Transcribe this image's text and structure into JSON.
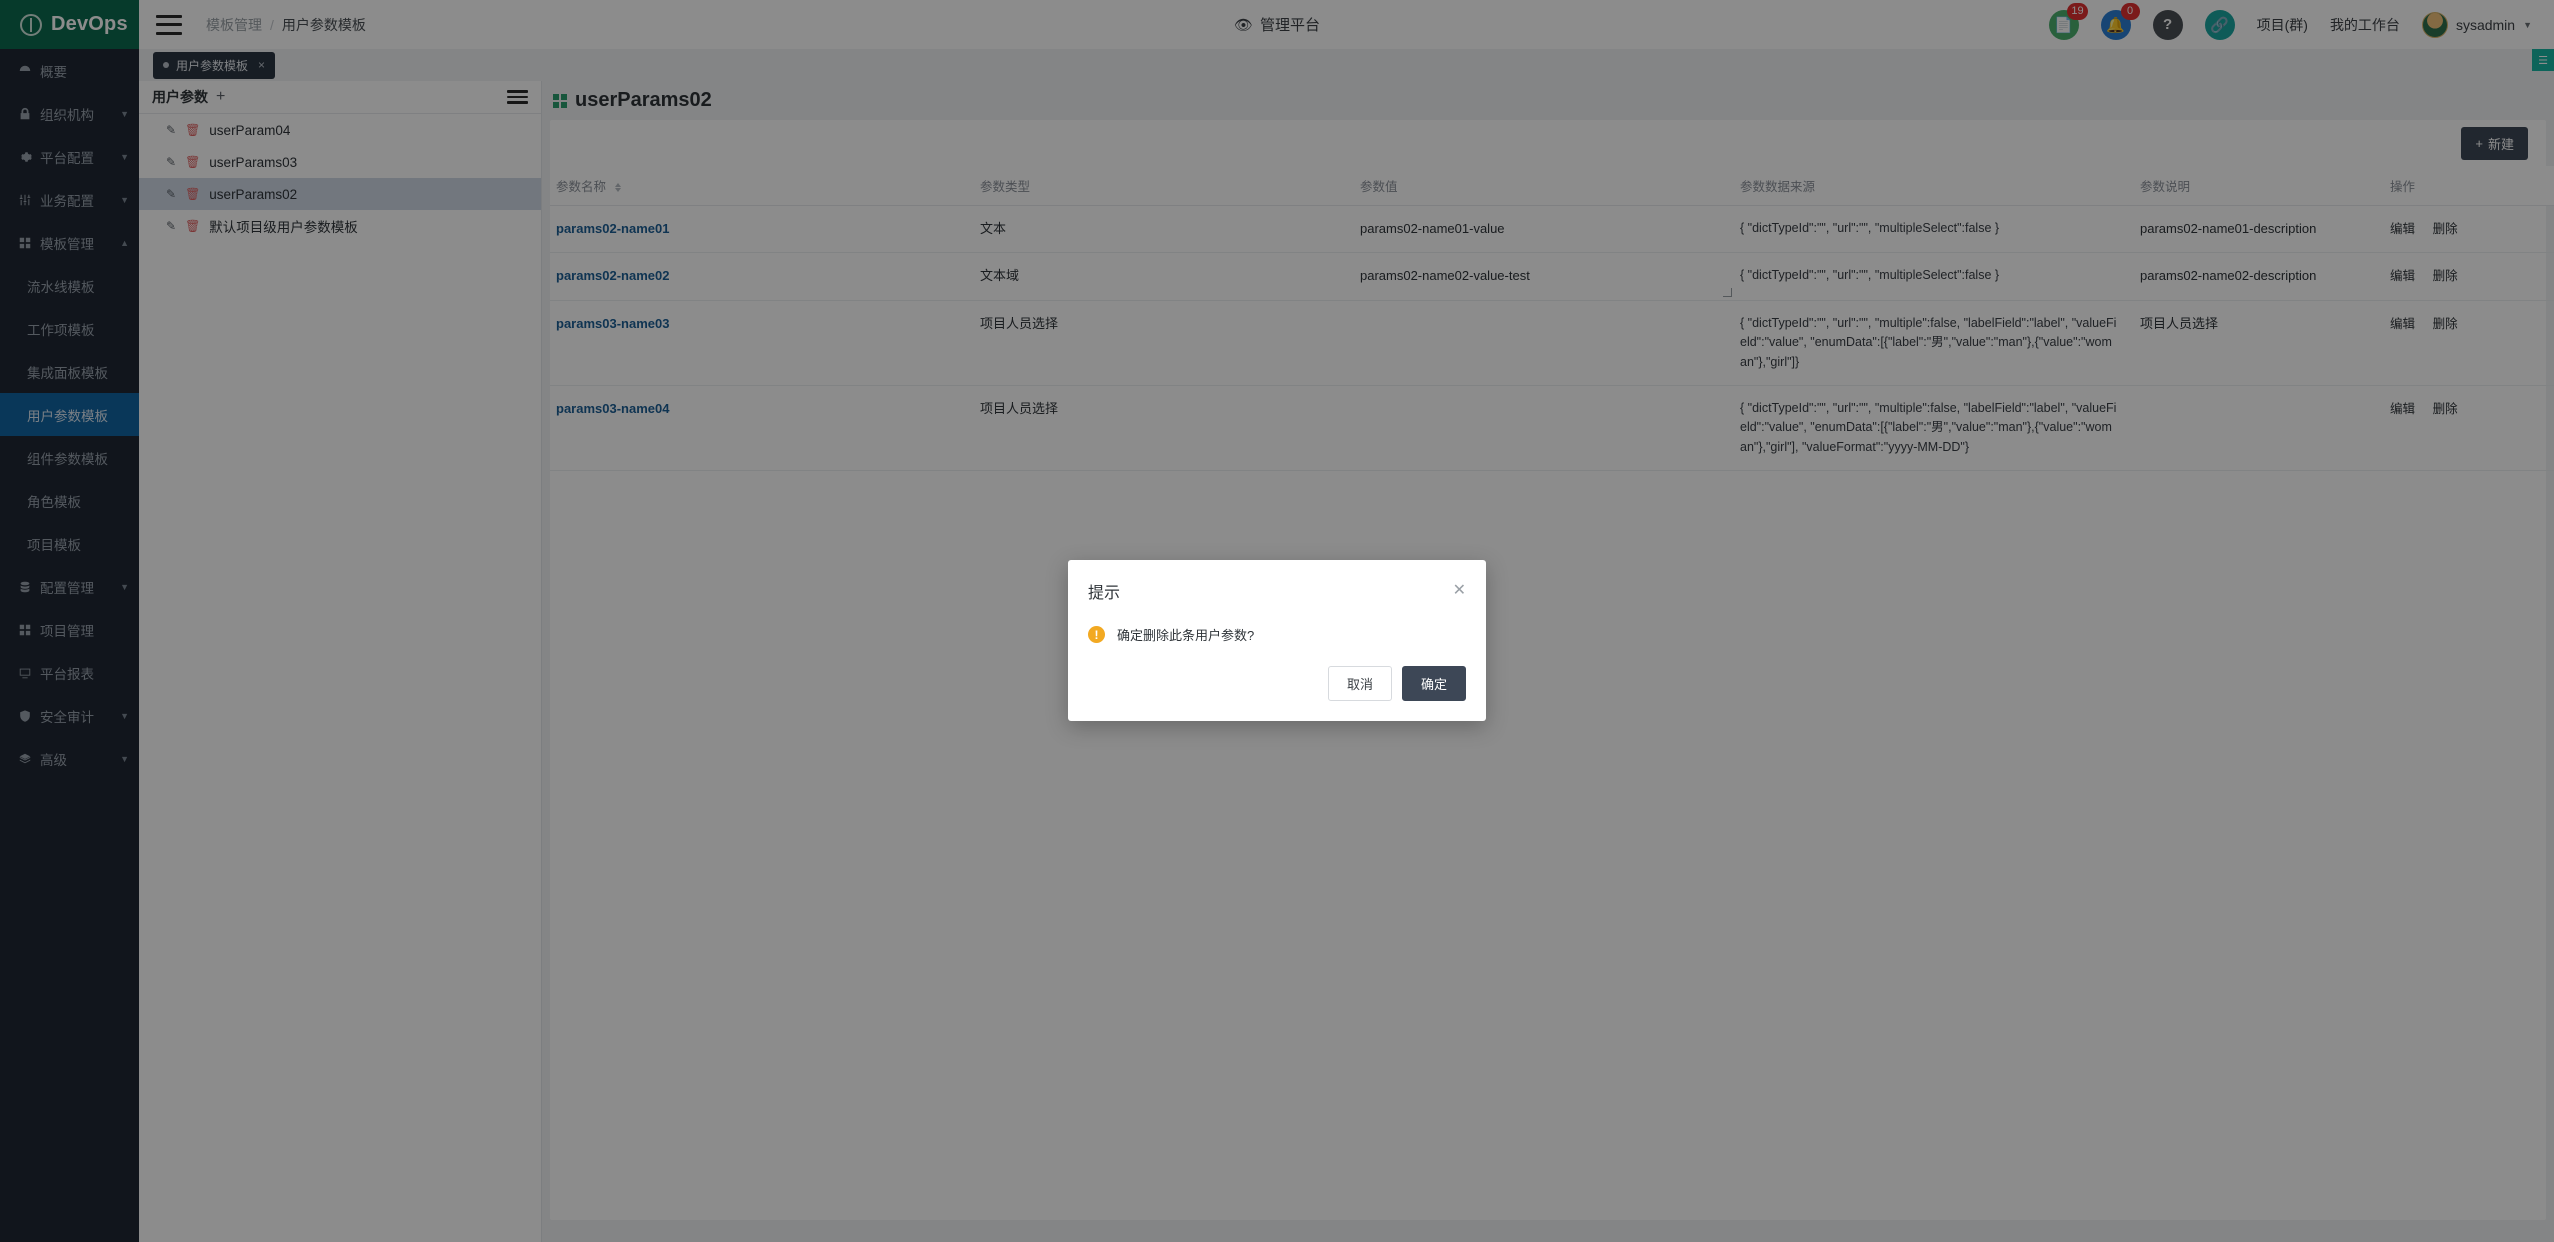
{
  "brand": {
    "name": "DevOps"
  },
  "header": {
    "breadcrumb": [
      "模板管理",
      "/",
      "用户参数模板"
    ],
    "platform_title": "管理平台",
    "eye_icon": "eye-icon",
    "doc_badge": "19",
    "bell_badge": "0",
    "links": [
      "项目(群)",
      "我的工作台"
    ],
    "user": "sysadmin"
  },
  "tab_chip": {
    "label": "用户参数模板",
    "close": "×"
  },
  "sidebar": {
    "items": [
      {
        "label": "概要",
        "icon": "dashboard-icon",
        "expandable": false
      },
      {
        "label": "组织机构",
        "icon": "lock-icon",
        "expandable": true
      },
      {
        "label": "平台配置",
        "icon": "gear-icon",
        "expandable": true
      },
      {
        "label": "业务配置",
        "icon": "sliders-icon",
        "expandable": true
      },
      {
        "label": "模板管理",
        "icon": "template-icon",
        "expandable": true
      }
    ],
    "template_children": [
      {
        "label": "流水线模板",
        "active": false
      },
      {
        "label": "工作项模板",
        "active": false
      },
      {
        "label": "集成面板模板",
        "active": false
      },
      {
        "label": "用户参数模板",
        "active": true
      },
      {
        "label": "组件参数模板",
        "active": false
      },
      {
        "label": "角色模板",
        "active": false
      },
      {
        "label": "项目模板",
        "active": false
      }
    ],
    "items_bottom": [
      {
        "label": "配置管理",
        "icon": "database-icon",
        "expandable": true
      },
      {
        "label": "项目管理",
        "icon": "grid-icon",
        "expandable": false
      },
      {
        "label": "平台报表",
        "icon": "monitor-icon",
        "expandable": false
      },
      {
        "label": "安全审计",
        "icon": "shield-icon",
        "expandable": true
      },
      {
        "label": "高级",
        "icon": "layers-icon",
        "expandable": true
      }
    ]
  },
  "list_panel": {
    "title": "用户参数",
    "add_icon": "plus-icon",
    "menu_icon": "menu-icon",
    "items": [
      {
        "name": "userParam04",
        "active": false
      },
      {
        "name": "userParams03",
        "active": false
      },
      {
        "name": "userParams02",
        "active": true
      },
      {
        "name": "默认项目级用户参数模板",
        "active": false
      }
    ]
  },
  "main": {
    "title": "userParams02",
    "new_button": "新建",
    "new_icon": "plus-icon",
    "columns": [
      "参数名称",
      "参数类型",
      "参数值",
      "参数数据来源",
      "参数说明",
      "操作"
    ],
    "rows": [
      {
        "name": "params02-name01",
        "type": "文本",
        "value": "params02-name01-value",
        "json": "{ \"dictTypeId\":\"\", \"url\":\"\", \"multipleSelect\":false }",
        "desc": "params02-name01-description",
        "ops": [
          "编辑",
          "删除"
        ]
      },
      {
        "name": "params02-name02",
        "type": "文本域",
        "value": "params02-name02-value-test",
        "json": "{ \"dictTypeId\":\"\", \"url\":\"\", \"multipleSelect\":false }",
        "desc": "params02-name02-description",
        "ops": [
          "编辑",
          "删除"
        ]
      },
      {
        "name": "params03-name03",
        "type": "项目人员选择",
        "value": "",
        "json": "{ \"dictTypeId\":\"\", \"url\":\"\", \"multiple\":false, \"labelField\":\"label\", \"valueField\":\"value\", \"enumData\":[{\"label\":\"男\",\"value\":\"man\"},{\"value\":\"woman\"},\"girl\"]}",
        "desc": "项目人员选择",
        "ops": [
          "编辑",
          "删除"
        ]
      },
      {
        "name": "params03-name04",
        "type": "项目人员选择",
        "value": "",
        "json": "{ \"dictTypeId\":\"\", \"url\":\"\", \"multiple\":false, \"labelField\":\"label\", \"valueField\":\"value\", \"enumData\":[{\"label\":\"男\",\"value\":\"man\"},{\"value\":\"woman\"},\"girl\"], \"valueFormat\":\"yyyy-MM-DD\"}",
        "desc": "",
        "ops": [
          "编辑",
          "删除"
        ]
      }
    ]
  },
  "modal": {
    "title": "提示",
    "close_icon": "close-icon",
    "warn_icon": "warning-icon",
    "message": "确定删除此条用户参数?",
    "cancel": "取消",
    "confirm": "确定"
  },
  "colors": {
    "brand_green": "#0c6b4f",
    "nav_bg": "#1f2733",
    "nav_active": "#1264a3",
    "link_blue": "#1d5f96",
    "btn_dark": "#3d4756",
    "warn": "#f2a922"
  }
}
